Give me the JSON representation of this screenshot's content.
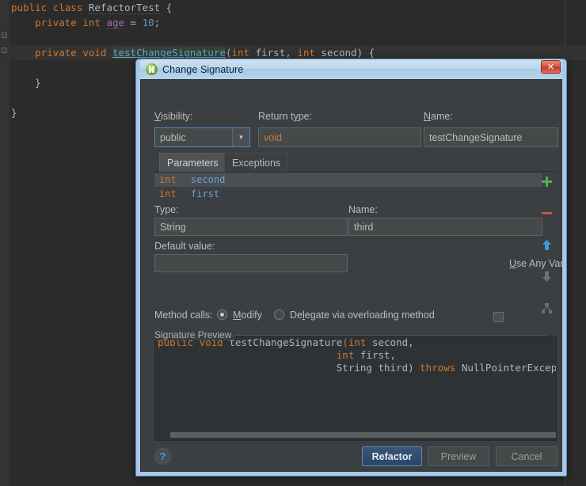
{
  "editor": {
    "lines": [
      {
        "indent": 0,
        "tokens": [
          {
            "t": "public ",
            "c": "kw"
          },
          {
            "t": "class ",
            "c": "kw"
          },
          {
            "t": "RefactorTest",
            "c": "cls"
          },
          {
            "t": " {",
            "c": "plainb"
          }
        ]
      },
      {
        "indent": 0,
        "tokens": [
          {
            "t": "    ",
            "c": "plainb"
          },
          {
            "t": "private ",
            "c": "kw"
          },
          {
            "t": "int ",
            "c": "kw"
          },
          {
            "t": "age",
            "c": "fld"
          },
          {
            "t": " = ",
            "c": "plainb"
          },
          {
            "t": "10",
            "c": "num"
          },
          {
            "t": ";",
            "c": "plainb"
          }
        ]
      },
      {
        "indent": 0,
        "tokens": []
      },
      {
        "indent": 0,
        "highlight": true,
        "tokens": [
          {
            "t": "    ",
            "c": "plainb"
          },
          {
            "t": "private ",
            "c": "kw"
          },
          {
            "t": "void ",
            "c": "kw"
          },
          {
            "t": "testChangeSignature",
            "c": "mname"
          },
          {
            "t": "(",
            "c": "plainb"
          },
          {
            "t": "int ",
            "c": "kw"
          },
          {
            "t": "first",
            "c": "param"
          },
          {
            "t": ", ",
            "c": "plainb"
          },
          {
            "t": "int ",
            "c": "kw"
          },
          {
            "t": "second",
            "c": "param"
          },
          {
            "t": ") {",
            "c": "plainb"
          }
        ]
      },
      {
        "indent": 0,
        "tokens": []
      },
      {
        "indent": 0,
        "tokens": [
          {
            "t": "    }",
            "c": "plainb"
          }
        ]
      },
      {
        "indent": 0,
        "tokens": []
      },
      {
        "indent": 0,
        "tokens": [
          {
            "t": "}",
            "c": "plainb"
          }
        ]
      }
    ]
  },
  "dialog": {
    "title": "Change Signature",
    "close_label": "✕",
    "visibility": {
      "label_pre": "V",
      "label_post": "isibility:",
      "value": "public",
      "arrow": "▼"
    },
    "return_type": {
      "label_pre": "Return t",
      "label_mid": "y",
      "label_post": "pe:",
      "value": "void"
    },
    "name": {
      "label_pre": "N",
      "label_post": "ame:",
      "value": "testChangeSignature"
    },
    "tabs": [
      {
        "label": "Parameters",
        "active": true
      },
      {
        "label": "Exceptions",
        "active": false
      }
    ],
    "parameters": {
      "columns": [
        "Type",
        "Name"
      ],
      "rows": [
        {
          "type": "int",
          "name": "second",
          "selected": true
        },
        {
          "type": "int",
          "name": "first",
          "selected": false
        }
      ]
    },
    "toolbar": [
      {
        "name": "add-parameter-button",
        "glyph": "+",
        "color": "#4faf5a",
        "enabled": true
      },
      {
        "name": "remove-parameter-button",
        "glyph": "—",
        "color": "#d0593f",
        "enabled": true
      },
      {
        "name": "move-up-button",
        "glyph": "▲",
        "color": "#3d9ad4",
        "enabled": true
      },
      {
        "name": "move-down-button",
        "glyph": "▼",
        "color": "#6d7173",
        "enabled": false
      },
      {
        "name": "propagate-parameters-button",
        "glyph": "⤫",
        "color": "#6d7173",
        "enabled": false
      }
    ],
    "param_editor": {
      "type_label": "Type:",
      "type_value": "String",
      "name_label": "Name:",
      "name_value": "third",
      "default_label": "Default value:",
      "default_value": "",
      "use_any_var_pre": "U",
      "use_any_var_post": "se Any Var",
      "use_any_var_checked": false
    },
    "method_calls": {
      "label": "Method calls:",
      "options": [
        {
          "label_pre": "M",
          "label_mid": "o",
          "label_post": "dify",
          "selected": true
        },
        {
          "label_pre": "De",
          "label_mid": "l",
          "label_post": "egate via overloading method",
          "selected": false
        }
      ]
    },
    "signature_preview": {
      "title": "Signature Preview",
      "lines": [
        [
          {
            "t": "public ",
            "c": "kw"
          },
          {
            "t": "void ",
            "c": "kw"
          },
          {
            "t": "testChangeSignature",
            "c": "plainb"
          },
          {
            "t": "(",
            "c": "kw"
          },
          {
            "t": "int ",
            "c": "kw"
          },
          {
            "t": "second,",
            "c": "plainb"
          }
        ],
        [
          {
            "t": "                              ",
            "c": "plainb"
          },
          {
            "t": "int ",
            "c": "kw"
          },
          {
            "t": "first,",
            "c": "plainb"
          }
        ],
        [
          {
            "t": "                              ",
            "c": "plainb"
          },
          {
            "t": "String third) ",
            "c": "plainb"
          },
          {
            "t": "throws ",
            "c": "kw"
          },
          {
            "t": "NullPointerException",
            "c": "plainb"
          }
        ]
      ]
    },
    "footer": {
      "help_label": "?",
      "refactor_label": "Refactor",
      "preview_label": "Preview",
      "cancel_label": "Cancel"
    }
  }
}
